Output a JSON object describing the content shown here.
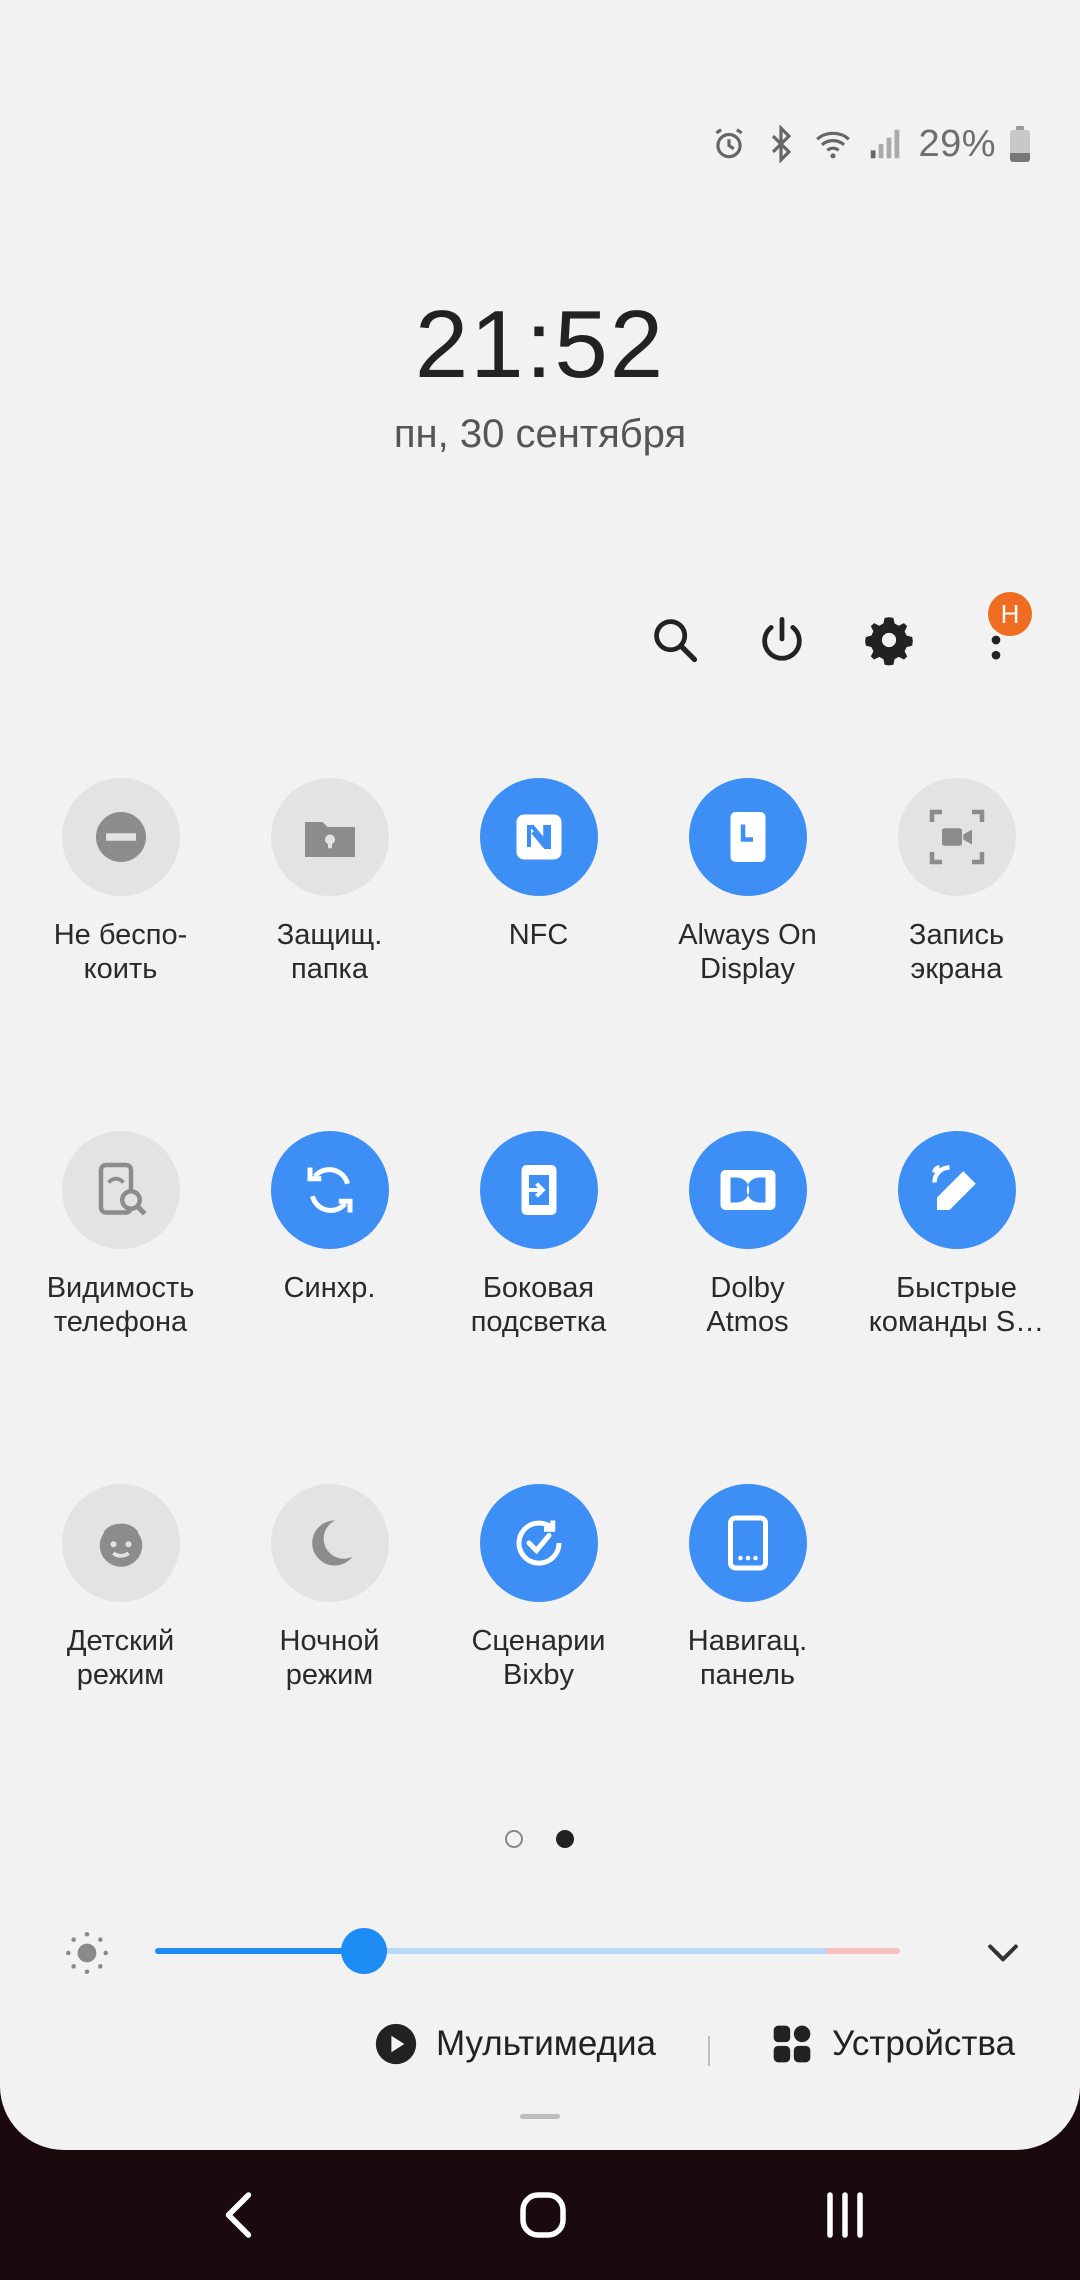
{
  "status_bar": {
    "battery_percent": "29%",
    "battery_level": 0.29,
    "icons": [
      "alarm-icon",
      "bluetooth-icon",
      "wifi-icon",
      "signal-icon"
    ]
  },
  "clock": {
    "time": "21:52",
    "date": "пн, 30 сентября"
  },
  "actions": {
    "icons": [
      "search-icon",
      "power-icon",
      "gear-icon",
      "more-icon"
    ],
    "badge": "H"
  },
  "tiles": [
    {
      "label": "Не беспо-\nкоить",
      "icon": "do-not-disturb-icon",
      "on": false
    },
    {
      "label": "Защищ.\nпапка",
      "icon": "secure-folder-icon",
      "on": false
    },
    {
      "label": "NFC",
      "icon": "nfc-icon",
      "on": true
    },
    {
      "label": "Always On\nDisplay",
      "icon": "always-on-display-icon",
      "on": true
    },
    {
      "label": "Запись\nэкрана",
      "icon": "screen-record-icon",
      "on": false
    },
    {
      "label": "Видимость\nтелефона",
      "icon": "phone-visibility-icon",
      "on": false
    },
    {
      "label": "Синхр.",
      "icon": "sync-icon",
      "on": true
    },
    {
      "label": "Боковая\nподсветка",
      "icon": "edge-lighting-icon",
      "on": true
    },
    {
      "label": "Dolby\nAtmos",
      "icon": "dolby-icon",
      "on": true
    },
    {
      "label": "Быстрые\nкоманды S…",
      "icon": "quick-commands-icon",
      "on": true
    },
    {
      "label": "Детский\nрежим",
      "icon": "kids-mode-icon",
      "on": false
    },
    {
      "label": "Ночной\nрежим",
      "icon": "night-mode-icon",
      "on": false
    },
    {
      "label": "Сценарии\nBixby",
      "icon": "bixby-routines-icon",
      "on": true
    },
    {
      "label": "Навигац.\nпанель",
      "icon": "navigation-bar-icon",
      "on": true
    }
  ],
  "pager": {
    "pages": 2,
    "current": 2
  },
  "brightness": {
    "level": 0.28
  },
  "bottom": {
    "media_label": "Мультимедиа",
    "devices_label": "Устройства"
  },
  "colors": {
    "accent": "#3d8ef5",
    "panel": "#f2f2f2",
    "tile_off": "#e3e3e3",
    "badge": "#ef6c21"
  }
}
